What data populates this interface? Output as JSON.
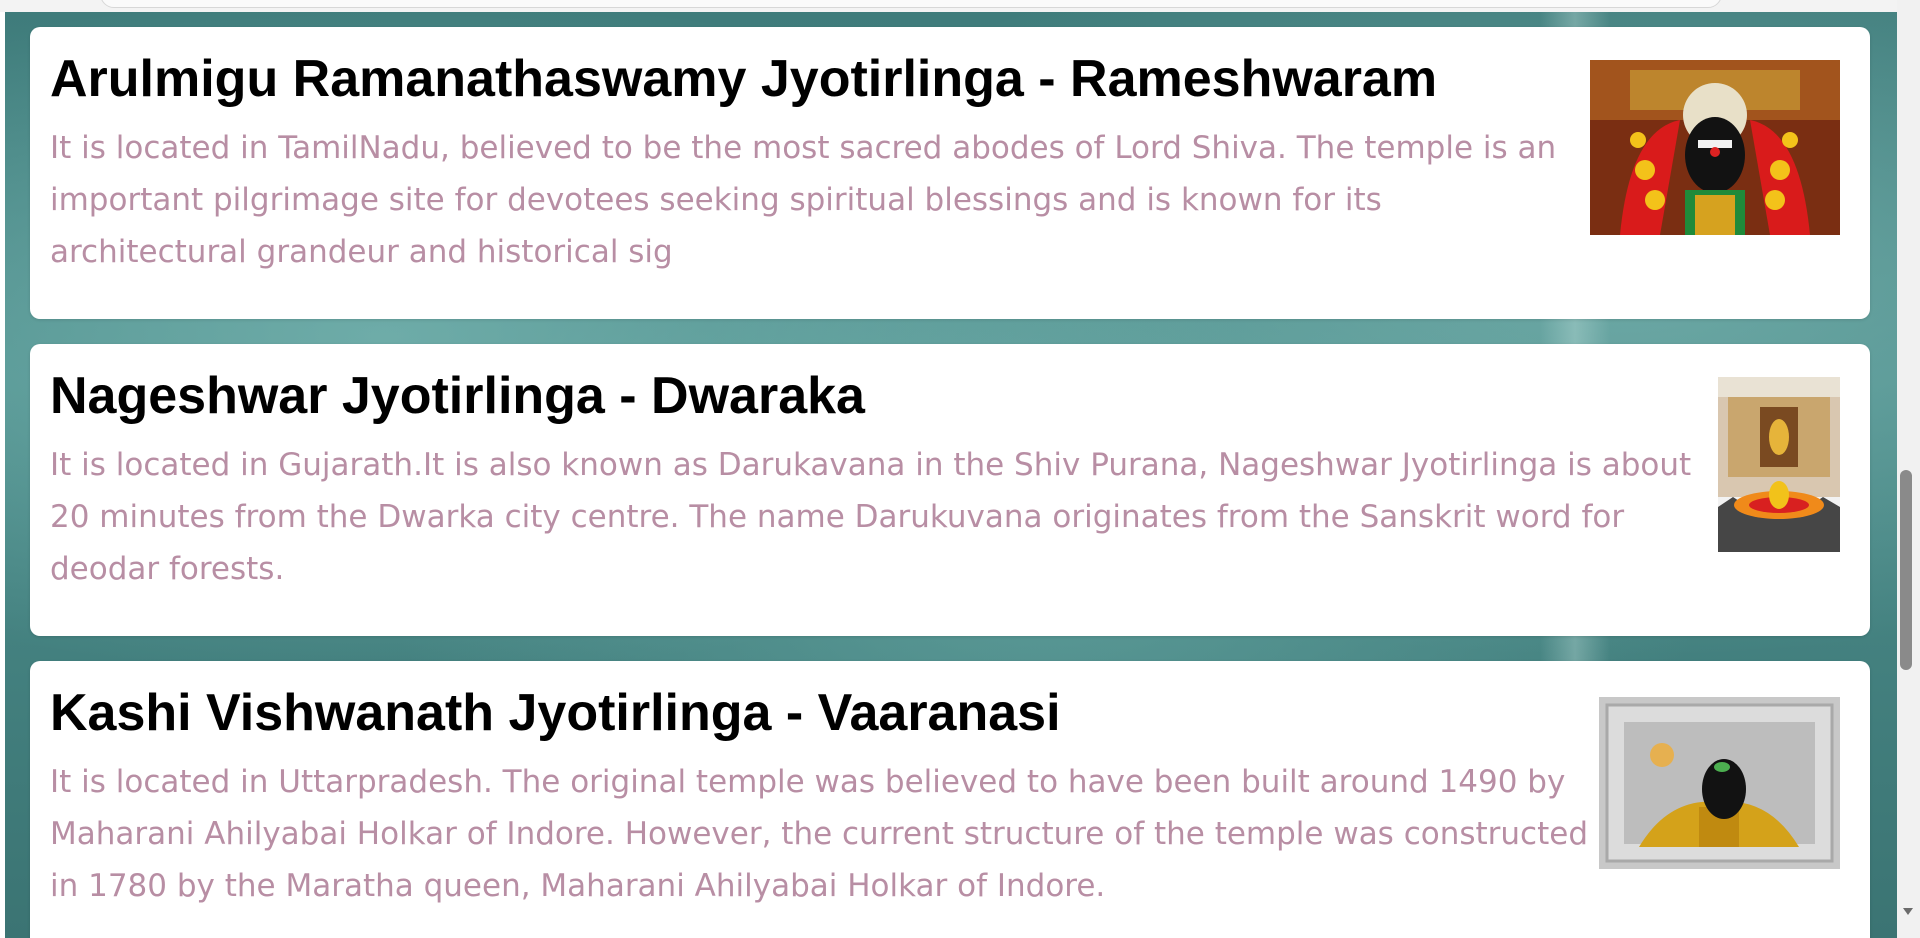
{
  "temples": [
    {
      "title": "Arulmigu Ramanathaswamy Jyotirlinga - Rameshwaram",
      "description": "It is located in TamilNadu, believed to be the most sacred abodes of Lord Shiva. The temple is an important pilgrimage site for devotees seeking spiritual blessings and is known for its architectural grandeur and historical sig"
    },
    {
      "title": "Nageshwar Jyotirlinga - Dwaraka",
      "description": "It is located in Gujarath.It is also known as Darukavana in the Shiv Purana, Nageshwar Jyotirlinga is about 20 minutes from the Dwarka city centre. The name Darukuvana originates from the Sanskrit word for deodar forests."
    },
    {
      "title": "Kashi Vishwanath Jyotirlinga - Vaaranasi",
      "description": "It is located in Uttarpradesh. The original temple was believed to have been built around 1490 by Maharani Ahilyabai Holkar of Indore. However, the current structure of the temple was constructed in 1780 by the Maratha queen, Maharani Ahilyabai Holkar of Indore."
    }
  ],
  "colors": {
    "title": "#000000",
    "description": "#b88ea4",
    "background": "#4b8c8a",
    "card": "#ffffff"
  }
}
